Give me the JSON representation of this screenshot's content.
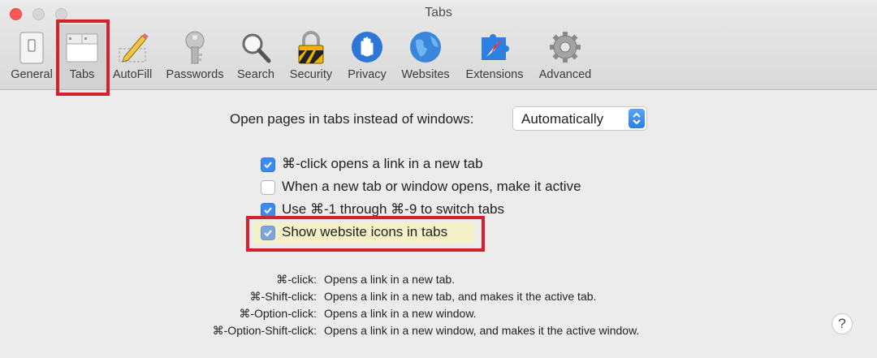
{
  "window": {
    "title": "Tabs"
  },
  "toolbar": {
    "items": [
      {
        "label": "General",
        "icon": "general-icon"
      },
      {
        "label": "Tabs",
        "icon": "tabs-icon"
      },
      {
        "label": "AutoFill",
        "icon": "pencil-icon"
      },
      {
        "label": "Passwords",
        "icon": "key-icon"
      },
      {
        "label": "Search",
        "icon": "magnifier-icon"
      },
      {
        "label": "Security",
        "icon": "lock-icon"
      },
      {
        "label": "Privacy",
        "icon": "hand-icon"
      },
      {
        "label": "Websites",
        "icon": "globe-icon"
      },
      {
        "label": "Extensions",
        "icon": "puzzle-icon"
      },
      {
        "label": "Advanced",
        "icon": "gear-icon"
      }
    ],
    "selected": "Tabs"
  },
  "open_pages": {
    "label": "Open pages in tabs instead of windows:",
    "value": "Automatically"
  },
  "options": [
    {
      "label": "⌘-click opens a link in a new tab",
      "checked": true
    },
    {
      "label": "When a new tab or window opens, make it active",
      "checked": false
    },
    {
      "label": "Use ⌘-1 through ⌘-9 to switch tabs",
      "checked": true
    },
    {
      "label": "Show website icons in tabs",
      "checked": true
    }
  ],
  "shortcuts": [
    {
      "keys": "⌘-click:",
      "desc": "Opens a link in a new tab."
    },
    {
      "keys": "⌘-Shift-click:",
      "desc": "Opens a link in a new tab, and makes it the active tab."
    },
    {
      "keys": "⌘-Option-click:",
      "desc": "Opens a link in a new window."
    },
    {
      "keys": "⌘-Option-Shift-click:",
      "desc": "Opens a link in a new window, and makes it the active window."
    }
  ],
  "help": {
    "label": "?"
  },
  "colors": {
    "accent": "#3c8af5",
    "annotation": "#d6202b",
    "highlight": "#f4f0c7"
  }
}
